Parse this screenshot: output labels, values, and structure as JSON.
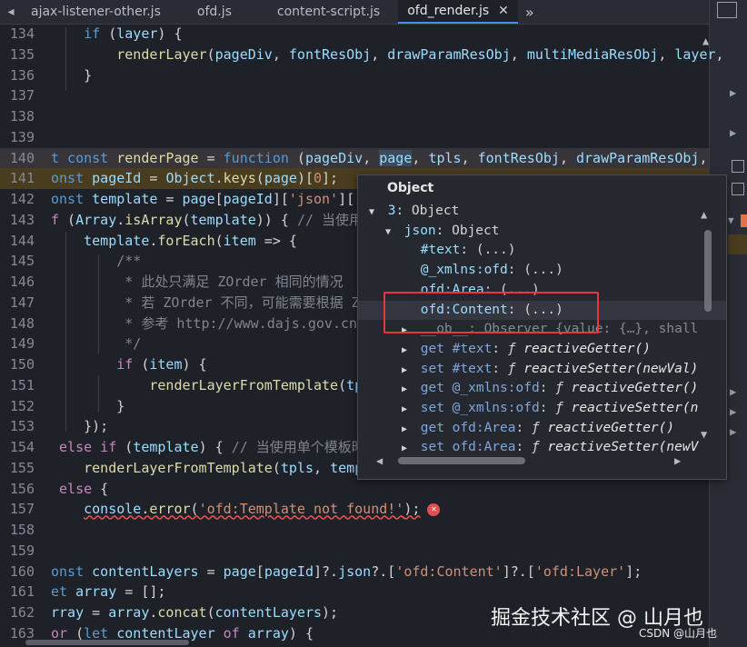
{
  "tabs": [
    {
      "label": "ajax-listener-other.js",
      "active": false
    },
    {
      "label": "ofd.js",
      "active": false
    },
    {
      "label": "content-script.js",
      "active": false
    },
    {
      "label": "ofd_render.js",
      "active": true
    }
  ],
  "tab_close": "✕",
  "tab_more": "»",
  "tab_nav": "◂",
  "code": [
    {
      "n": "134",
      "html": "    <span class='k'>if</span> (<span class='v'>layer</span>) {"
    },
    {
      "n": "135",
      "html": "        <span class='f'>renderLayer</span>(<span class='v'>pageDiv</span>, <span class='v'>fontResObj</span>, <span class='v'>drawParamResObj</span>, <span class='v'>multiMediaResObj</span>, <span class='v'>layer</span>,"
    },
    {
      "n": "136",
      "html": "    }"
    },
    {
      "n": "137",
      "html": ""
    },
    {
      "n": "138",
      "html": ""
    },
    {
      "n": "139",
      "html": ""
    },
    {
      "n": "140",
      "html": "<span class='k'>t const</span> <span class='f'>renderPage</span> = <span class='k'>function</span> (<span class='v'>pageDiv</span>, <span class='v sel'>page</span>, <span class='v'>tpls</span>, <span class='v'>fontResObj</span>, <span class='v'>drawParamResObj</span>,"
    },
    {
      "n": "141",
      "html": "<span class='k'>onst</span> <span class='v'>pageId</span> = <span class='v'>Object</span>.<span class='f'>keys</span>(<span class='v'>page</span>)[<span class='s'>0</span>];"
    },
    {
      "n": "142",
      "html": "<span class='k'>onst</span> <span class='v'>template</span> = <span class='v'>page</span>[<span class='v'>pageId</span>][<span class='s'>'json'</span>][<span class='s'>'o</span>"
    },
    {
      "n": "143",
      "html": "<span class='kw2'>f</span> (<span class='v'>Array</span>.<span class='f'>isArray</span>(<span class='v'>template</span>)) { <span class='c'>// 当使用</span>"
    },
    {
      "n": "144",
      "html": "    <span class='v'>template</span>.<span class='f'>forEach</span>(<span class='v'>item</span> => {"
    },
    {
      "n": "145",
      "html": "        <span class='c'>/**</span>"
    },
    {
      "n": "146",
      "html": "<span class='c'>         * 此处只满足 ZOrder 相同的情况</span>"
    },
    {
      "n": "147",
      "html": "<span class='c'>         * 若 ZOrder 不同，可能需要根据 ZO</span>"
    },
    {
      "n": "148",
      "html": "<span class='c'>         * 参考 http://www.dajs.gov.cn/a</span>"
    },
    {
      "n": "149",
      "html": "<span class='c'>         */</span>"
    },
    {
      "n": "150",
      "html": "        <span class='kw2'>if</span> (<span class='v'>item</span>) {"
    },
    {
      "n": "151",
      "html": "            <span class='f'>renderLayerFromTemplate</span>(<span class='v'>tpls</span>"
    },
    {
      "n": "152",
      "html": "        }"
    },
    {
      "n": "153",
      "html": "    });"
    },
    {
      "n": "154",
      "html": " <span class='kw2'>else if</span> (<span class='v'>template</span>) { <span class='c'>// 当使用单个模板时</span>"
    },
    {
      "n": "155",
      "html": "    <span class='f'>renderLayerFromTemplate</span>(<span class='v'>tpls</span>, <span class='v'>templa</span>"
    },
    {
      "n": "156",
      "html": " <span class='kw2'>else</span> {"
    },
    {
      "n": "157",
      "html": "    <span class='squig'><span class='v'>console</span>.<span class='f'>error</span>(<span class='s'>'ofd:Template not found!'</span>);</span><span class='errdot'>✕</span>"
    },
    {
      "n": "158",
      "html": ""
    },
    {
      "n": "159",
      "html": ""
    },
    {
      "n": "160",
      "html": "<span class='k'>onst</span> <span class='v'>contentLayers</span> = <span class='v'>page</span>[<span class='v'>pageId</span>]?.<span class='v'>json</span>?.[<span class='s'>'ofd:Content'</span>]?.[<span class='s'>'ofd:Layer'</span>];"
    },
    {
      "n": "161",
      "html": "<span class='k'>et</span> <span class='v'>array</span> = [];"
    },
    {
      "n": "162",
      "html": "<span class='v'>rray</span> = <span class='v'>array</span>.<span class='f'>concat</span>(<span class='v'>contentLayers</span>);"
    },
    {
      "n": "163",
      "html": "<span class='kw2'>or</span> (<span class='k'>let</span> <span class='v'>contentLayer</span> <span class='kw2'>of</span> <span class='v'>array</span>) {"
    }
  ],
  "popup": {
    "title": "Object",
    "rows": [
      {
        "indent": 0,
        "tri": "▼",
        "html": "<span class='pk'>3</span>: Object"
      },
      {
        "indent": 1,
        "tri": "▼",
        "html": "<span class='pk'>json</span>: Object"
      },
      {
        "indent": 2,
        "tri": "",
        "html": "<span class='pk'>#text</span>: (...)"
      },
      {
        "indent": 2,
        "tri": "",
        "html": "<span class='pk'>@_xmlns:ofd</span>: (...)"
      },
      {
        "indent": 2,
        "tri": "",
        "html": "<span class='pk'>ofd:Area</span>: (...)"
      },
      {
        "indent": 2,
        "tri": "",
        "html": "<span class='pk'>ofd:Content</span>: (...)"
      },
      {
        "indent": 2,
        "tri": "▶",
        "html": "<span class='pgrey'>__ob__: Observer {value: {…}, shall</span>"
      },
      {
        "indent": 2,
        "tri": "▶",
        "html": "<span class='pk2'>get #text</span>: <span class='pf'>ƒ</span> <span class='pfn'>reactiveGetter()</span>"
      },
      {
        "indent": 2,
        "tri": "▶",
        "html": "<span class='pk2'>set #text</span>: <span class='pf'>ƒ</span> <span class='pfn'>reactiveSetter(newVal)</span>"
      },
      {
        "indent": 2,
        "tri": "▶",
        "html": "<span class='pk2'>get @_xmlns:ofd</span>: <span class='pf'>ƒ</span> <span class='pfn'>reactiveGetter()</span>"
      },
      {
        "indent": 2,
        "tri": "▶",
        "html": "<span class='pk2'>set @_xmlns:ofd</span>: <span class='pf'>ƒ</span> <span class='pfn'>reactiveSetter(n</span>"
      },
      {
        "indent": 2,
        "tri": "▶",
        "html": "<span class='pk2'>get ofd:Area</span>: <span class='pf'>ƒ</span> <span class='pfn'>reactiveGetter()</span>"
      },
      {
        "indent": 2,
        "tri": "▶",
        "html": "<span class='pk2'>set ofd:Area</span>: <span class='pf'>ƒ</span> <span class='pfn'>reactiveSetter(newV</span>"
      }
    ]
  },
  "watermark": "掘金技术社区 @ 山月也",
  "watermark_small": "CSDN @山月也",
  "colors": {
    "accent": "#4d8bf0",
    "highlight": "#e83838"
  }
}
